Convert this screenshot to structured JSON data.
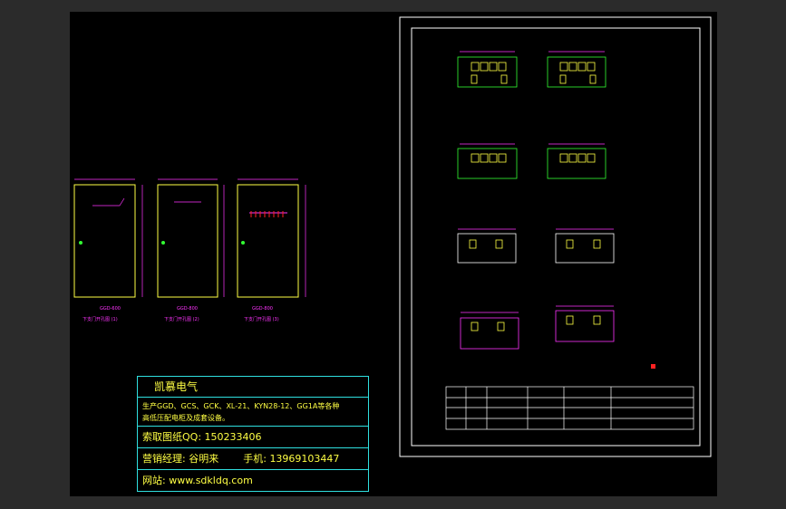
{
  "window": {
    "background": "#2b2b2b",
    "canvas_background": "#000000"
  },
  "colors": {
    "frame": "#ffffff",
    "panel": "#ffff44",
    "dim": "#ff33ff",
    "banner_border": "#2fe0e0",
    "green": "#33ff33",
    "red": "#ff2222"
  },
  "cabinet_views": [
    {
      "model": "GGD-600",
      "caption": "下支门开孔图 (1)"
    },
    {
      "model": "GGD-800",
      "caption": "下支门开孔图 (2)"
    },
    {
      "model": "GGD-800",
      "caption": "下支门开孔图 (3)"
    }
  ],
  "banner": {
    "company": "凯慕电气",
    "products_line1": "生产GGD、GCS、GCK、XL-21、KYN28-12、GG1A等各种",
    "products_line2": "高低压配电柜及成套设备。",
    "qq_label": "索取图纸QQ:",
    "qq": "150233406",
    "manager_label": "营销经理:",
    "manager": "谷明来",
    "phone_label": "手机:",
    "phone": "13969103447",
    "site_label": "网站:",
    "site": "www.sdkldq.com"
  }
}
